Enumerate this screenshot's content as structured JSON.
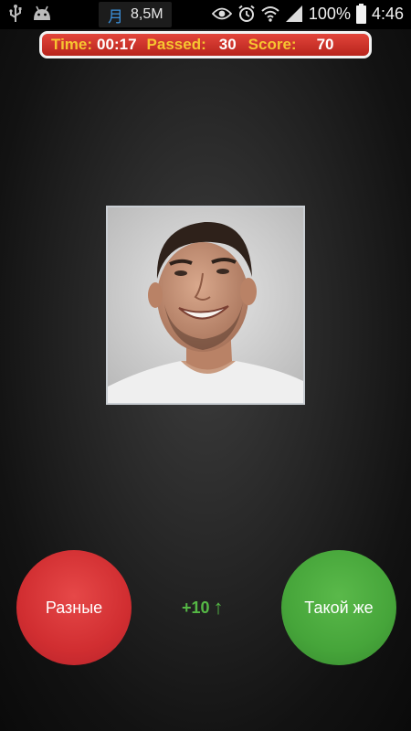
{
  "status_bar": {
    "memory": "8,5M",
    "calendar_glyph": "月",
    "battery": "100%",
    "time": "4:46"
  },
  "score_bar": {
    "time_label": "Time:",
    "time_value": "00:17",
    "passed_label": "Passed:",
    "passed_value": "30",
    "score_label": "Score:",
    "score_value": "70"
  },
  "buttons": {
    "different": "Разные",
    "same": "Такой же"
  },
  "bonus": {
    "text": "+10",
    "arrow": "↑"
  },
  "colors": {
    "score_bar_bg": "#d4332a",
    "label_yellow": "#f7c530",
    "button_red": "#d12e31",
    "button_green": "#46a53a",
    "bonus_green": "#55b845"
  },
  "icons": [
    "usb-icon",
    "android-icon",
    "calendar-icon",
    "eye-icon",
    "alarm-icon",
    "wifi-icon",
    "signal-icon",
    "battery-icon"
  ]
}
